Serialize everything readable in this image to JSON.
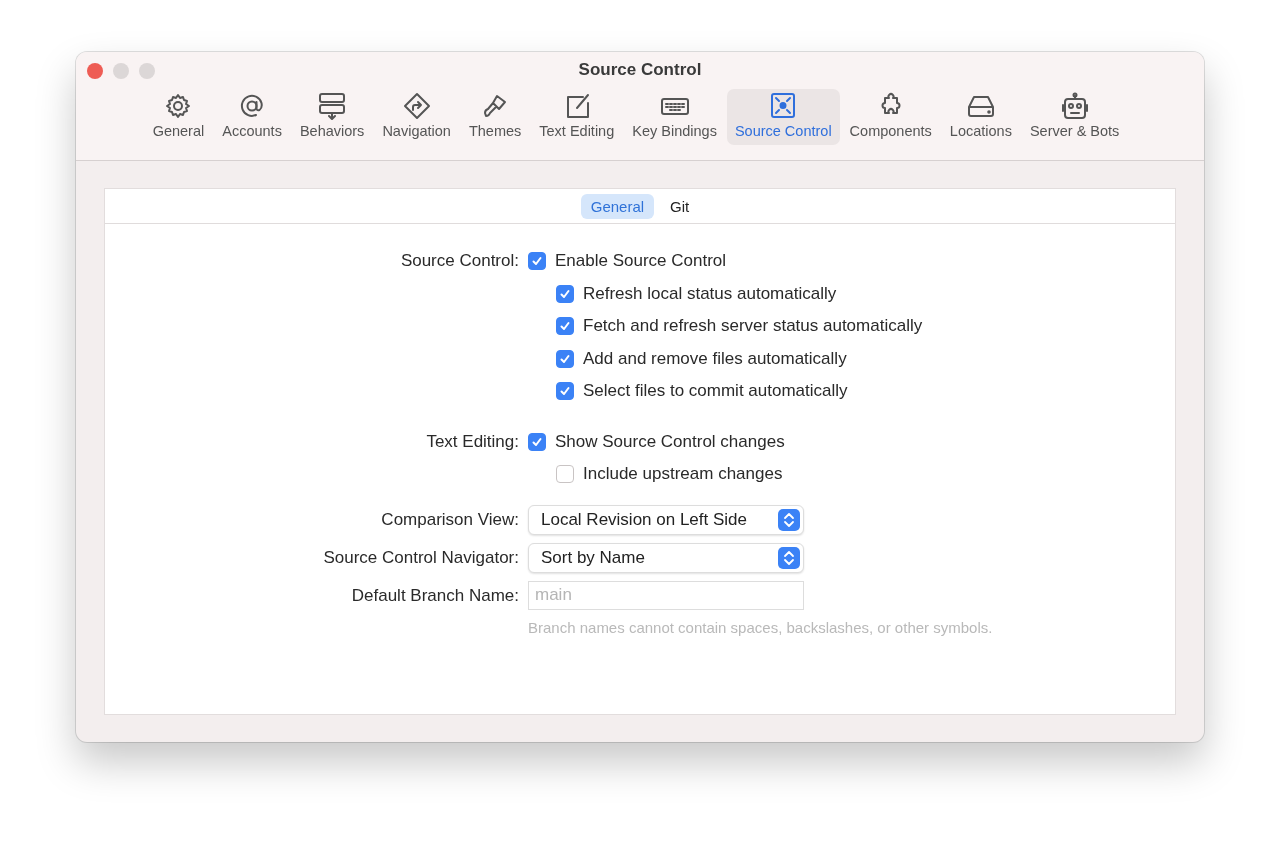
{
  "window": {
    "title": "Source Control"
  },
  "toolbar": [
    {
      "label": "General",
      "selected": false
    },
    {
      "label": "Accounts",
      "selected": false
    },
    {
      "label": "Behaviors",
      "selected": false
    },
    {
      "label": "Navigation",
      "selected": false
    },
    {
      "label": "Themes",
      "selected": false
    },
    {
      "label": "Text Editing",
      "selected": false
    },
    {
      "label": "Key Bindings",
      "selected": false
    },
    {
      "label": "Source Control",
      "selected": true
    },
    {
      "label": "Components",
      "selected": false
    },
    {
      "label": "Locations",
      "selected": false
    },
    {
      "label": "Server & Bots",
      "selected": false
    }
  ],
  "tabs": [
    {
      "label": "General",
      "selected": true
    },
    {
      "label": "Git",
      "selected": false
    }
  ],
  "settings": [
    {
      "kind": "checkbox",
      "label": "Source Control:",
      "option": {
        "label": "Enable Source Control",
        "checked": true,
        "children": [
          {
            "label": "Refresh local status automatically",
            "checked": true
          },
          {
            "label": "Fetch and refresh server status automatically",
            "checked": true
          },
          {
            "label": "Add and remove files automatically",
            "checked": true
          },
          {
            "label": "Select files to commit automatically",
            "checked": true
          }
        ]
      }
    },
    {
      "kind": "checkbox",
      "label": "Text Editing:",
      "option": {
        "label": "Show Source Control changes",
        "checked": true,
        "children": [
          {
            "label": "Include upstream changes",
            "checked": false
          }
        ]
      }
    },
    {
      "kind": "popup",
      "label": "Comparison View:",
      "value": "Local Revision on Left Side"
    },
    {
      "kind": "popup",
      "label": "Source Control Navigator:",
      "value": "Sort by Name"
    },
    {
      "kind": "field",
      "label": "Default Branch Name:",
      "placeholder": "main",
      "hint": "Branch names cannot contain spaces, backslashes, or other symbols."
    }
  ]
}
